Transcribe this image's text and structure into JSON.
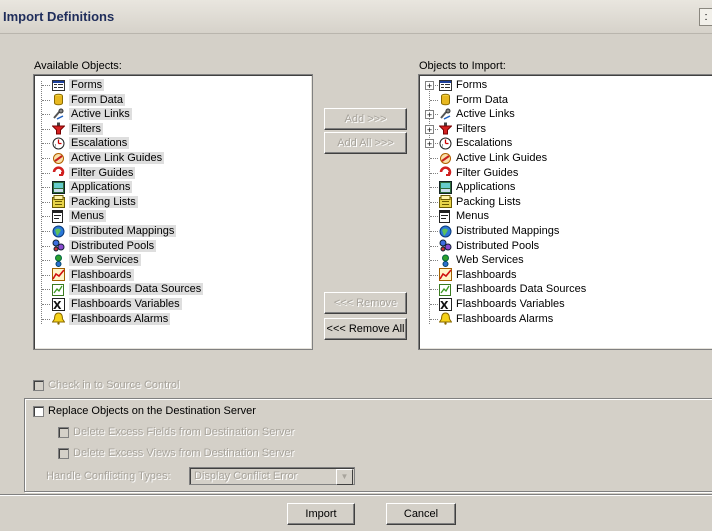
{
  "window": {
    "title": "Import Definitions",
    "close_glyph": ":"
  },
  "available": {
    "label": "Available Objects:",
    "items": [
      {
        "label": "Forms",
        "icon": "form-icon"
      },
      {
        "label": "Form Data",
        "icon": "database-icon"
      },
      {
        "label": "Active Links",
        "icon": "active-link-icon"
      },
      {
        "label": "Filters",
        "icon": "filter-icon"
      },
      {
        "label": "Escalations",
        "icon": "escalation-icon"
      },
      {
        "label": "Active Link Guides",
        "icon": "active-link-guide-icon"
      },
      {
        "label": "Filter Guides",
        "icon": "filter-guide-icon"
      },
      {
        "label": "Applications",
        "icon": "application-icon"
      },
      {
        "label": "Packing Lists",
        "icon": "packing-list-icon"
      },
      {
        "label": "Menus",
        "icon": "menu-icon"
      },
      {
        "label": "Distributed Mappings",
        "icon": "distributed-mapping-icon"
      },
      {
        "label": "Distributed Pools",
        "icon": "distributed-pool-icon"
      },
      {
        "label": "Web Services",
        "icon": "web-service-icon"
      },
      {
        "label": "Flashboards",
        "icon": "flashboard-icon"
      },
      {
        "label": "Flashboards Data Sources",
        "icon": "flashboard-data-source-icon"
      },
      {
        "label": "Flashboards Variables",
        "icon": "flashboard-variable-icon"
      },
      {
        "label": "Flashboards Alarms",
        "icon": "flashboard-alarm-icon"
      }
    ]
  },
  "import": {
    "label": "Objects to Import:",
    "items": [
      {
        "label": "Forms",
        "expandable": true
      },
      {
        "label": "Form Data",
        "expandable": false
      },
      {
        "label": "Active Links",
        "expandable": true
      },
      {
        "label": "Filters",
        "expandable": true
      },
      {
        "label": "Escalations",
        "expandable": true
      },
      {
        "label": "Active Link Guides",
        "expandable": false
      },
      {
        "label": "Filter Guides",
        "expandable": false
      },
      {
        "label": "Applications",
        "expandable": false
      },
      {
        "label": "Packing Lists",
        "expandable": false
      },
      {
        "label": "Menus",
        "expandable": false
      },
      {
        "label": "Distributed Mappings",
        "expandable": false
      },
      {
        "label": "Distributed Pools",
        "expandable": false
      },
      {
        "label": "Web Services",
        "expandable": false
      },
      {
        "label": "Flashboards",
        "expandable": false
      },
      {
        "label": "Flashboards Data Sources",
        "expandable": false
      },
      {
        "label": "Flashboards Variables",
        "expandable": false
      },
      {
        "label": "Flashboards Alarms",
        "expandable": false
      }
    ]
  },
  "buttons": {
    "add": "Add >>>",
    "add_all": "Add All >>>",
    "remove": "<<< Remove",
    "remove_all": "<<< Remove All",
    "import": "Import",
    "cancel": "Cancel"
  },
  "options": {
    "check_in": "Check in to Source Control",
    "replace": "Replace Objects on the Destination Server",
    "delete_fields": "Delete Excess Fields from Destination Server",
    "delete_views": "Delete Excess Views from Destination Server",
    "handle_label": "Handle Conflicting Types:",
    "handle_value": "Display Conflict Error"
  }
}
